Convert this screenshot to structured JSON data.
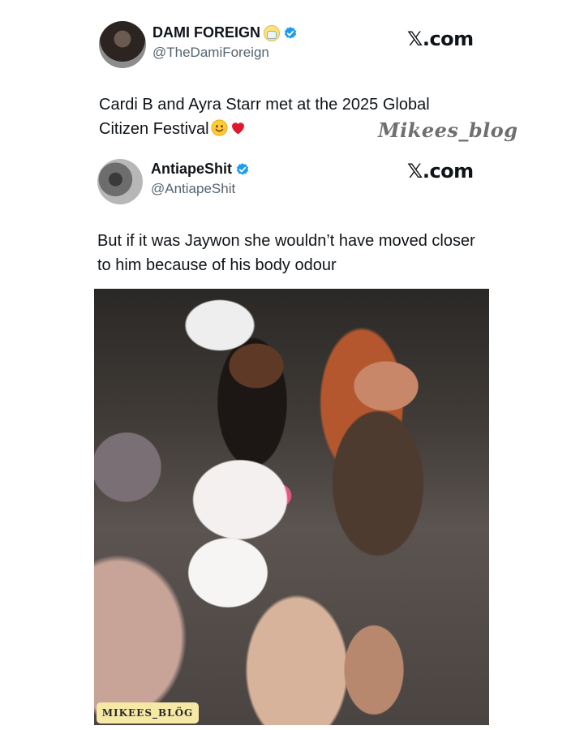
{
  "tweets": [
    {
      "display_name": "DAMI FOREIGN",
      "handle": "@TheDamiForeign",
      "source": "𝕏.com",
      "text": "Cardi B and Ayra Starr met at the 2025 Global Citizen Festival",
      "name_emoji": "face-with-medical-mask-icon",
      "text_emojis": [
        "smiling-face-icon",
        "red-heart-icon"
      ]
    },
    {
      "display_name": "AntiapeShit",
      "handle": "@AntiapeShit",
      "source": "𝕏.com",
      "text": "But if it was Jaywon she wouldn’t have moved closer to him because of his body odour"
    }
  ],
  "watermark": "Mikees_blog",
  "photo_badge": "MIKEES_BLÖG",
  "colors": {
    "verified_blue": "#1d9bf0",
    "handle_gray": "#536471",
    "text_dark": "#0f1419",
    "badge_bg": "#f6e9a6"
  }
}
